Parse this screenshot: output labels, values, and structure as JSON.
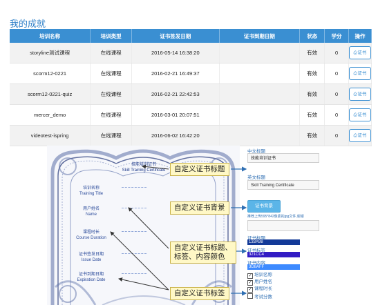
{
  "page": {
    "title": "我的成就"
  },
  "table": {
    "headers": [
      "培训名称",
      "培训类型",
      "证书签发日期",
      "证书到期日期",
      "状态",
      "学分",
      "操作"
    ],
    "rows": [
      {
        "name": "storyline测试课程",
        "type": "在线课程",
        "issue_date": "2016-05-14 16:38:20",
        "expire_date": "",
        "status": "有效",
        "credit": "0",
        "action": "证书"
      },
      {
        "name": "scorm12-0221",
        "type": "在线课程",
        "issue_date": "2016-02-21 16:49:37",
        "expire_date": "",
        "status": "有效",
        "credit": "0",
        "action": "证书"
      },
      {
        "name": "scorm12-0221-quiz",
        "type": "在线课程",
        "issue_date": "2016-02-21 22:42:53",
        "expire_date": "",
        "status": "有效",
        "credit": "0",
        "action": "证书"
      },
      {
        "name": "mercer_demo",
        "type": "在线课程",
        "issue_date": "2016-03-01 20:07:51",
        "expire_date": "",
        "status": "有效",
        "credit": "0",
        "action": "证书"
      },
      {
        "name": "videotest-ispring",
        "type": "在线课程",
        "issue_date": "2016-06-02 16:42:20",
        "expire_date": "",
        "status": "有效",
        "credit": "0",
        "action": "证书"
      }
    ]
  },
  "certificate": {
    "title_cn": "技能培训证书",
    "title_en": "Skill Training Certificate",
    "fields": [
      {
        "cn": "培训名称",
        "en": "Training Title"
      },
      {
        "cn": "用户姓名",
        "en": "Name"
      },
      {
        "cn": "课程时长",
        "en": "Course Duration"
      },
      {
        "cn": "证书签发日期",
        "en": "Issue Date"
      },
      {
        "cn": "证书到期日期",
        "en": "Expiration Date"
      }
    ]
  },
  "annotations": {
    "title": "自定义证书标题",
    "background": "自定义证书背景",
    "colors": "自定义证书标题、标签、内容颜色",
    "labels": "自定义证书标签"
  },
  "settings": {
    "cn_title_label": "中文标题",
    "cn_title_value": "技能培训证书",
    "en_title_label": "英文标题",
    "en_title_value": "Skill Training Certificate",
    "bg_button": "证书背景",
    "hint": "推荐上传595*842像素的jpg文件,谢谢",
    "title_color_label": "证书标题",
    "title_color_value": "133A98",
    "label_color_label": "证书标签",
    "label_color_value": "321CC4",
    "content_color_label": "证书内容",
    "content_color_value": "3D8AFF",
    "checkboxes": [
      {
        "label": "培训名称",
        "checked": true
      },
      {
        "label": "用户姓名",
        "checked": true
      },
      {
        "label": "课程时长",
        "checked": true
      },
      {
        "label": "考试分数",
        "checked": false
      }
    ],
    "check_mark": "✓"
  },
  "colors": {
    "header_blue": "#3a8fd2",
    "title_color": "#133A98",
    "label_color": "#321CC4",
    "content_color": "#3D8AFF"
  }
}
